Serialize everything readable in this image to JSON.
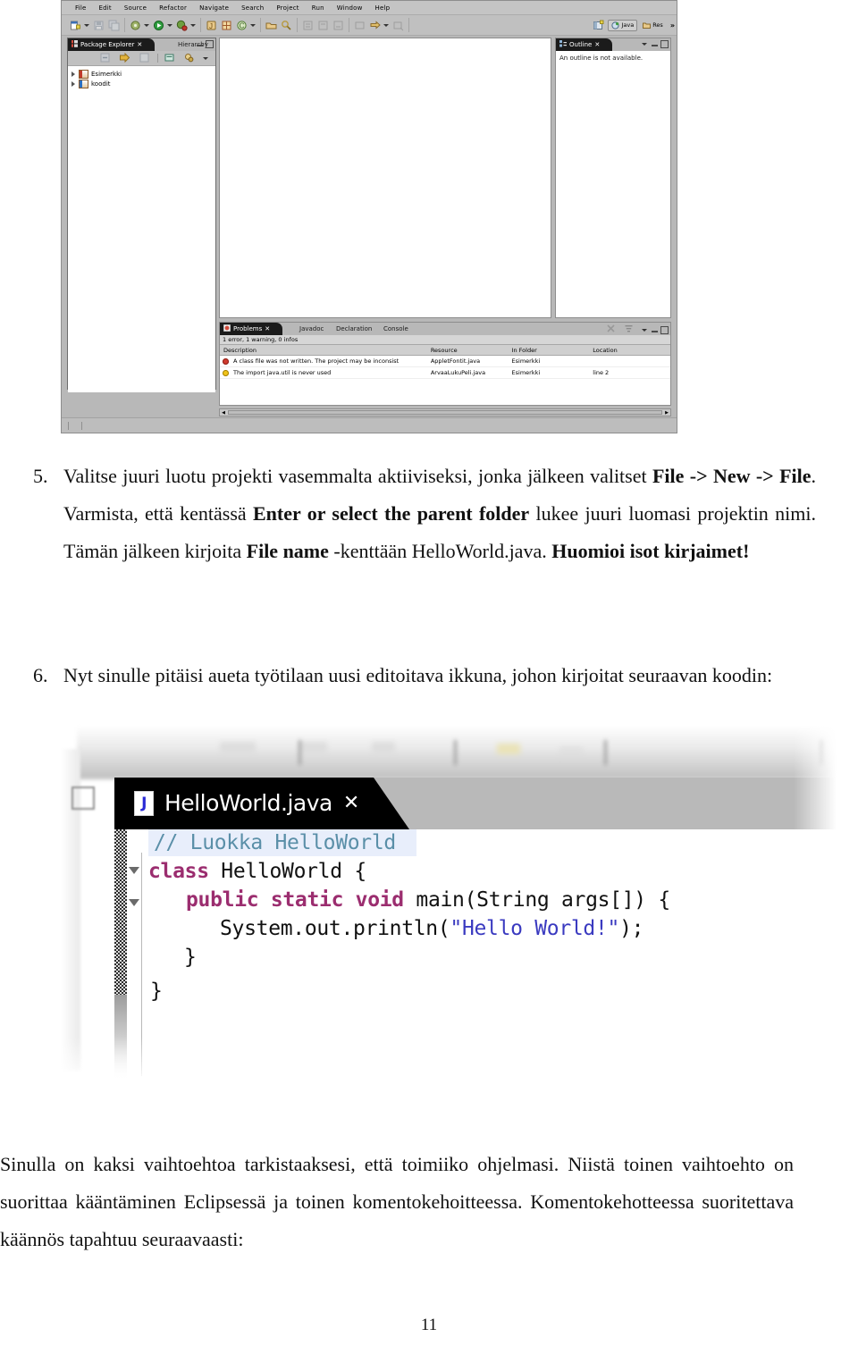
{
  "screenshot_eclipse": {
    "menu": [
      "File",
      "Edit",
      "Source",
      "Refactor",
      "Navigate",
      "Search",
      "Project",
      "Run",
      "Window",
      "Help"
    ],
    "toolbar_icons": [
      "new-wizard-icon",
      "save-icon",
      "save-all-icon",
      "external-tools-icon",
      "run-icon",
      "debug-icon",
      "new-java-project-icon",
      "new-package-icon",
      "new-class-icon",
      "open-type-icon",
      "search-icon",
      "next-annotation-icon",
      "previous-annotation-icon",
      "last-edit-icon",
      "back-icon",
      "forward-icon",
      "pin-editor-icon"
    ],
    "perspectives": {
      "open-perspective-icon": "open-perspective-icon",
      "items": [
        {
          "label": "Java",
          "selected": true
        },
        {
          "label": "Res",
          "selected": false
        }
      ],
      "overflow": "»"
    },
    "package_explorer": {
      "tab_label": "Package Explorer",
      "tab_close": "✕",
      "inactive_tab": "Hierarchy",
      "toolbar_icons": [
        "collapse-all-icon",
        "link-with-editor-icon",
        "focus-icon",
        "view-menu-icon",
        "filter-icon",
        "view-dropdown-icon"
      ],
      "tree": [
        {
          "label": "Esimerkki",
          "icon": "java-project-icon"
        },
        {
          "label": "koodit",
          "icon": "folder-project-icon"
        }
      ]
    },
    "outline": {
      "tab_label": "Outline",
      "tab_close": "✕",
      "message": "An outline is not available."
    },
    "problems": {
      "tabs": [
        {
          "label": "Problems",
          "active": true
        },
        {
          "label": "Javadoc",
          "active": false
        },
        {
          "label": "Declaration",
          "active": false
        },
        {
          "label": "Console",
          "active": false
        }
      ],
      "summary": "1 error, 1 warning, 0 infos",
      "columns": [
        "Description",
        "Resource",
        "In Folder",
        "Location"
      ],
      "rows": [
        {
          "severity": "error",
          "description": "A class file was not written. The project may be inconsist",
          "resource": "AppletFontit.java",
          "in_folder": "Esimerkki",
          "location": ""
        },
        {
          "severity": "warning",
          "description": "The import java.util is never used",
          "resource": "ArvaaLukuPeli.java",
          "in_folder": "Esimerkki",
          "location": "line 2"
        }
      ]
    }
  },
  "document": {
    "items": [
      {
        "number": "5.",
        "segments": [
          {
            "text": "Valitse juuri luotu projekti vasemmalta aktiiviseksi, jonka jälkeen valitset ",
            "bold": false
          },
          {
            "text": "File -> New -> File",
            "bold": true
          },
          {
            "text": ". Varmista, että kentässä ",
            "bold": false
          },
          {
            "text": "Enter or select the parent folder",
            "bold": true
          },
          {
            "text": " lukee juuri luomasi projektin nimi. Tämän jälkeen kirjoita ",
            "bold": false
          },
          {
            "text": "File name",
            "bold": true
          },
          {
            "text": " -kenttään HelloWorld.java. ",
            "bold": false
          },
          {
            "text": "Huomioi isot kirjaimet!",
            "bold": true
          }
        ]
      },
      {
        "number": "6.",
        "segments": [
          {
            "text": "Nyt sinulle pitäisi aueta työtilaan uusi editoitava ikkuna, johon kirjoitat seuraavan koodin:",
            "bold": false
          }
        ]
      }
    ],
    "closing_paragraph": "Sinulla on kaksi vaihtoehtoa tarkistaaksesi, että toimiiko ohjelmasi. Niistä toinen vaihtoehto on suorittaa kääntäminen Eclipsessä ja toinen komentokehoitteessa. Komentokehotteessa suoritettava käännös tapahtuu seuraavaasti:",
    "page_number": "11"
  },
  "screenshot_editor": {
    "tab": {
      "icon": "java-file-icon",
      "icon_letter": "J",
      "label": "HelloWorld.java",
      "close": "✕"
    },
    "code_lines": [
      {
        "indent": 0,
        "text": "// Luokka HelloWorld",
        "style": "comment",
        "highlighted": true,
        "fold": false
      },
      {
        "indent": 0,
        "text": "class HelloWorld {",
        "style": "keyword-line",
        "highlighted": false,
        "fold": true
      },
      {
        "indent": 1,
        "text": "public static void main(String args[]) {",
        "style": "keyword-line",
        "highlighted": false,
        "fold": true
      },
      {
        "indent": 2,
        "text": "System.out.println(\"Hello World!\");",
        "style": "string-line",
        "highlighted": false,
        "fold": false
      },
      {
        "indent": 1,
        "text": "}",
        "style": "plain",
        "highlighted": false,
        "fold": false
      },
      {
        "indent": 0,
        "text": "}",
        "style": "plain",
        "highlighted": false,
        "fold": false
      }
    ],
    "colors": {
      "comment": "#5a8fa8",
      "keyword": "#9b2d6f",
      "string": "#3a3ac0",
      "tab_background": "#000000",
      "line_highlight": "#e8eefb"
    }
  }
}
